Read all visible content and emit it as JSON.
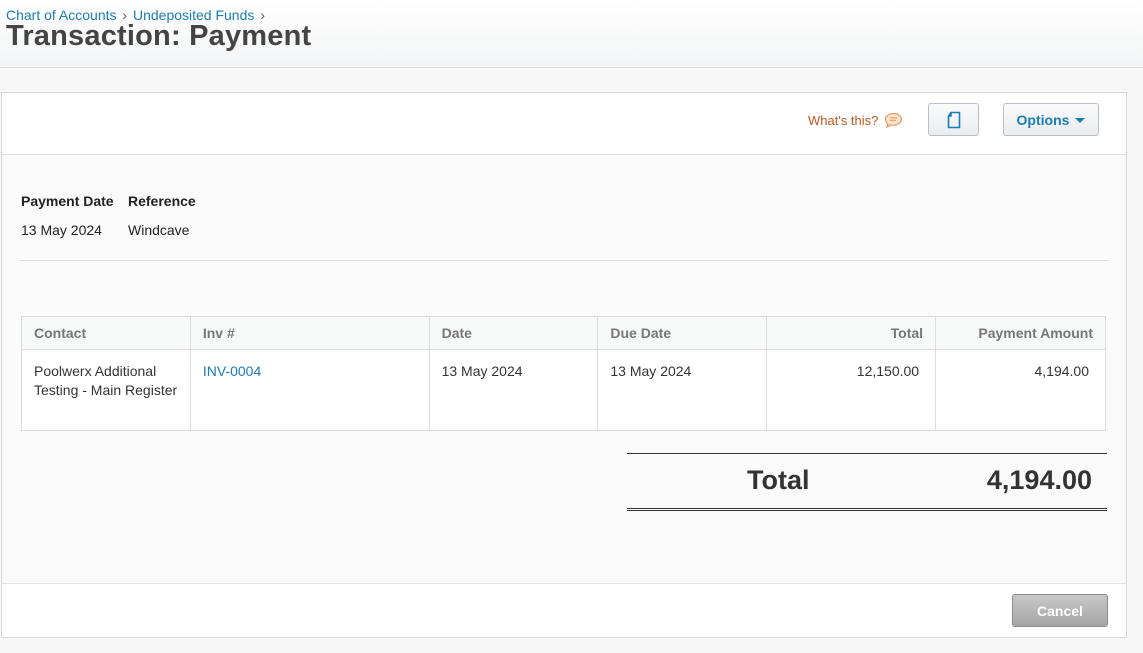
{
  "breadcrumb": {
    "items": [
      "Chart of Accounts",
      "Undeposited Funds"
    ],
    "separator": "›"
  },
  "page": {
    "title": "Transaction: Payment"
  },
  "toolbar": {
    "whats_this": "What's this?",
    "whats_this_icon": "speech-bubble-icon",
    "doc_icon": "document-icon",
    "options_label": "Options",
    "options_icon": "caret-down-icon"
  },
  "meta": {
    "payment_date_label": "Payment Date",
    "payment_date": "13 May 2024",
    "reference_label": "Reference",
    "reference": "Windcave"
  },
  "table": {
    "headers": [
      "Contact",
      "Inv #",
      "Date",
      "Due Date",
      "Total",
      "Payment Amount"
    ],
    "rows": [
      {
        "contact": "Poolwerx Additional Testing - Main Register",
        "invoice": "INV-0004",
        "date": "13 May 2024",
        "due_date": "13 May 2024",
        "total": "12,150.00",
        "payment_amount": "4,194.00"
      }
    ]
  },
  "summary": {
    "total_label": "Total",
    "total_value": "4,194.00"
  },
  "footer": {
    "cancel_label": "Cancel"
  },
  "colors": {
    "link": "#1a7db5",
    "help": "#c2571c",
    "title": "#444444"
  }
}
